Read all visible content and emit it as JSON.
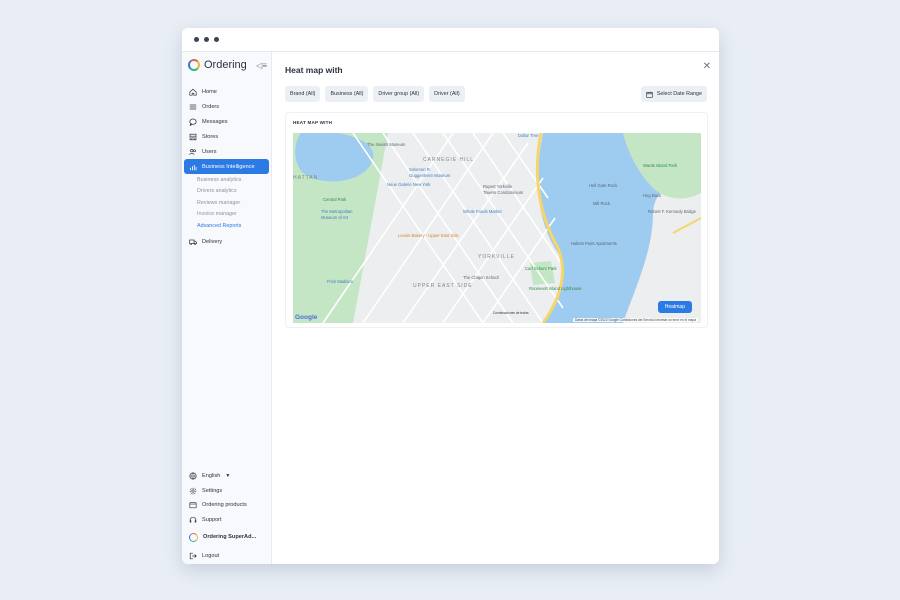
{
  "window": {
    "dots": 3
  },
  "sidebar": {
    "brand": "Ordering",
    "items": [
      {
        "label": "Home",
        "icon": "home-icon"
      },
      {
        "label": "Orders",
        "icon": "list-icon"
      },
      {
        "label": "Messages",
        "icon": "chat-icon"
      },
      {
        "label": "Stores",
        "icon": "store-icon"
      },
      {
        "label": "Users",
        "icon": "users-icon"
      },
      {
        "label": "Business Intelligence",
        "icon": "chart-icon",
        "active": true
      }
    ],
    "subitems": [
      {
        "label": "Business analytics"
      },
      {
        "label": "Drivers analytics"
      },
      {
        "label": "Reviews manager"
      },
      {
        "label": "Invoice manager"
      },
      {
        "label": "Advanced Reports",
        "active": true
      }
    ],
    "delivery": "Delivery",
    "bottom": {
      "language": "English",
      "settings": "Settings",
      "products": "Ordering products",
      "support": "Support",
      "account": "Ordering SuperAd...",
      "logout": "Logout"
    }
  },
  "main": {
    "title": "Heat map with",
    "filters": [
      "Brand (All)",
      "Business (All)",
      "Driver group (All)",
      "Driver (All)"
    ],
    "date_range": "Select Date Range",
    "card_title": "HEAT MAP WITH",
    "heatmap_button": "Heatmap",
    "map": {
      "labels": {
        "jewish_museum": "The Jewish Museum",
        "carnegie_hill": "CARNEGIE HILL",
        "solomon": "Solomon R.",
        "guggenheim": "Guggenheim Museum",
        "hattan": "HATTAN",
        "neue": "Neue Galerie New York",
        "rupert": "Rupert Yorkville",
        "towers": "Towers Condominium",
        "central_park": "Central Park",
        "met1": "The Metropolitan",
        "met2": "Museum of Art",
        "whole_foods": "Whole Foods Market",
        "hell_gate": "Hell Gate Rock",
        "mill_rock": "Mill Rock",
        "hog_back": "Hog Back",
        "kennedy": "Robert F. Kennedy Bridge",
        "randalls": "Wards Island Park",
        "levain": "Levain Bakery - Upper East Side",
        "yorkville": "YORKVILLE",
        "hallets": "Hallets Point Apartments",
        "carl_schurz": "Carl Schurz Park",
        "chapin": "The Chapin School",
        "upper_east": "UPPER EAST SIDE",
        "roosevelt": "Roosevelt Island Lighthouse",
        "frick": "Frick Madison",
        "dollar_tree": "Dollar Tree",
        "shortcuts": "Combinaciones de teclas",
        "attribution": "Datos del mapa ©2022 Google   Condiciones del Servicio   Informar un error en el mapa",
        "google": "Google"
      }
    }
  },
  "colors": {
    "accent": "#2c7be5",
    "water": "#9ecbf0",
    "park": "#c4e6c4",
    "street": "#ffffff",
    "highway": "#f6d56b"
  }
}
